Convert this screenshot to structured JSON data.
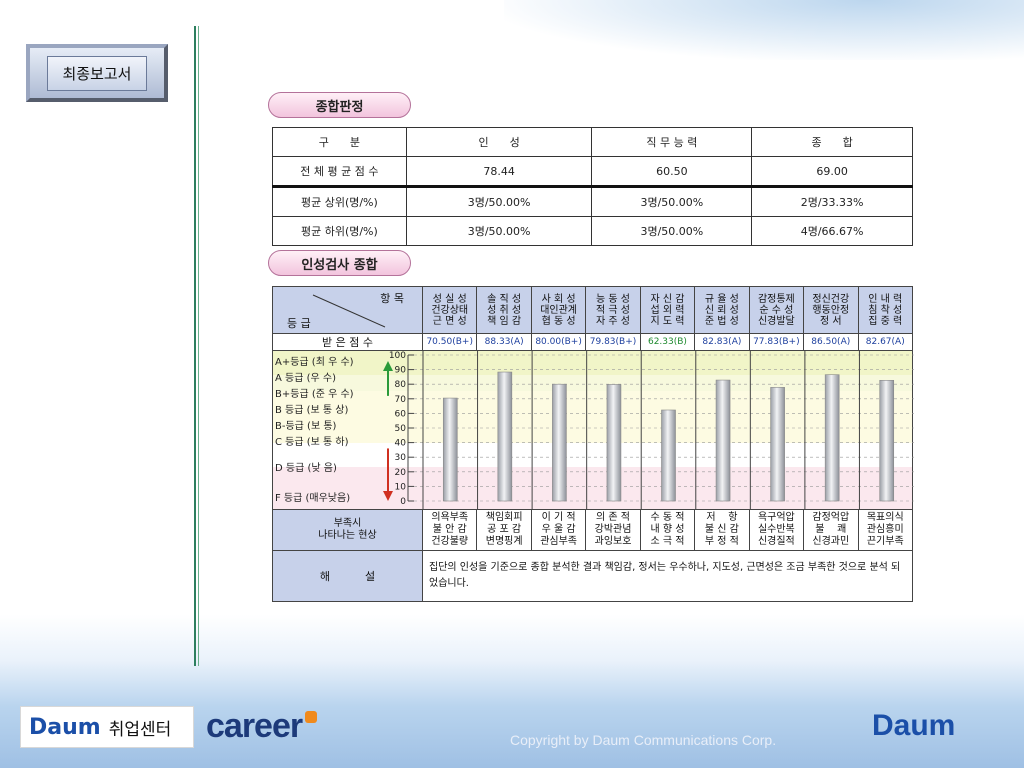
{
  "menu": {
    "report_button": "최종보고서"
  },
  "section1": {
    "title": "종합판정",
    "headers": [
      "구      분",
      "인      성",
      "직 무 능 력",
      "종      합"
    ],
    "rows": [
      {
        "label": "전 체 평 균 점 수",
        "values": [
          "78.44",
          "60.50",
          "69.00"
        ]
      },
      {
        "label": "평균 상위(명/%)",
        "values": [
          "3명/50.00%",
          "3명/50.00%",
          "2명/33.33%"
        ]
      },
      {
        "label": "평균 하위(명/%)",
        "values": [
          "3명/50.00%",
          "3명/50.00%",
          "4명/66.67%"
        ]
      }
    ]
  },
  "section2": {
    "title": "인성검사 종합",
    "corner_top": "항 목",
    "corner_bottom": "등 급",
    "items": [
      {
        "lines": [
          "성 실 성",
          "건강상태",
          "근 면 성"
        ],
        "score": "70.50(B+)",
        "value": 70.5,
        "lack": [
          "의욕부족",
          "불 안 감",
          "건강불량"
        ]
      },
      {
        "lines": [
          "솔 직 성",
          "성 취 성",
          "책 임 감"
        ],
        "score": "88.33(A)",
        "value": 88.33,
        "lack": [
          "책임회피",
          "공 포 감",
          "변명핑계"
        ]
      },
      {
        "lines": [
          "사 회 성",
          "대인관계",
          "협 동 성"
        ],
        "score": "80.00(B+)",
        "value": 80.0,
        "lack": [
          "이 기 적",
          "우 울 감",
          "관심부족"
        ]
      },
      {
        "lines": [
          "능 동 성",
          "적 극 성",
          "자 주 성"
        ],
        "score": "79.83(B+)",
        "value": 79.83,
        "lack": [
          "의 존 적",
          "강박관념",
          "과잉보호"
        ]
      },
      {
        "lines": [
          "자 신 감",
          "섭 외 력",
          "지 도 력"
        ],
        "score": "62.33(B)",
        "value": 62.33,
        "lack": [
          "수 동 적",
          "내 향 성",
          "소 극 적"
        ]
      },
      {
        "lines": [
          "규 율 성",
          "신 뢰 성",
          "준 법 성"
        ],
        "score": "82.83(A)",
        "value": 82.83,
        "lack": [
          "저    항",
          "불 신 감",
          "부 정 적"
        ]
      },
      {
        "lines": [
          "감정통제",
          "순 수 성",
          "신경발달"
        ],
        "score": "77.83(B+)",
        "value": 77.83,
        "lack": [
          "욕구억압",
          "실수반복",
          "신경질적"
        ]
      },
      {
        "lines": [
          "정신건강",
          "행동안정",
          "정    서"
        ],
        "score": "86.50(A)",
        "value": 86.5,
        "lack": [
          "감정억압",
          "불    쾌",
          "신경과민"
        ]
      },
      {
        "lines": [
          "인 내 력",
          "침 착 성",
          "집 중 력"
        ],
        "score": "82.67(A)",
        "value": 82.67,
        "lack": [
          "목표의식",
          "관심흥미",
          "끈기부족"
        ]
      }
    ],
    "score_row_label": "받 은 점 수",
    "grades": [
      "A+등급 (최 우 수)",
      "A 등급 (우      수)",
      "B+등급 (준 우 수)",
      "B 등급 (보 통 상)",
      "B-등급 (보      통)",
      "C 등급 (보 통 하)",
      "D 등급 (낮      음)",
      "F 등급 (매우낮음)"
    ],
    "scale_ticks": [
      "100",
      "90",
      "80",
      "70",
      "60",
      "50",
      "40",
      "30",
      "20",
      "10",
      "0"
    ],
    "deficiency_label_1": "부족시",
    "deficiency_label_2": "나타나는 현상",
    "comment_label": "해          설",
    "comment": "집단의 인성을 기준으로 종합 분석한 결과 책임감, 정서는 우수하나, 지도성, 근면성은 조금 부족한 것으로 분석 되었습니다."
  },
  "footer": {
    "daum_logo": "Daum",
    "center": "취업센터",
    "career": "career",
    "copyright": "Copyright by Daum Communications Corp.",
    "daum_logo_right": "Daum"
  },
  "colors": {
    "accent_line": "#2d7f5f",
    "header_bg": "#c7d1ea",
    "bar": "#b8bcc4"
  }
}
